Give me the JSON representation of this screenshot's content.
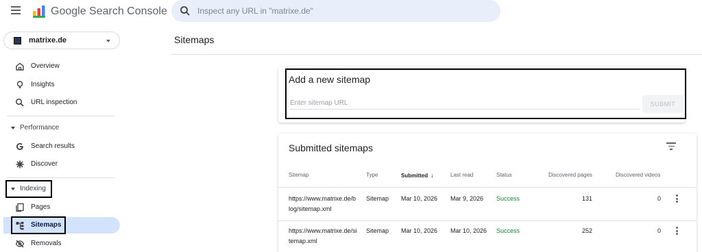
{
  "app": {
    "brand": "Google Search Console",
    "search_placeholder": "Inspect any URL in \"matrixe.de\""
  },
  "property": {
    "name": "matrixe.de"
  },
  "sidebar": {
    "items_top": [
      {
        "label": "Overview",
        "icon": "home-icon"
      },
      {
        "label": "Insights",
        "icon": "lightbulb-icon"
      },
      {
        "label": "URL inspection",
        "icon": "search-icon"
      }
    ],
    "performance": {
      "label": "Performance",
      "items": [
        {
          "label": "Search results",
          "icon": "google-g-icon"
        },
        {
          "label": "Discover",
          "icon": "asterisk-icon"
        }
      ]
    },
    "indexing": {
      "label": "Indexing",
      "items": [
        {
          "label": "Pages",
          "icon": "pages-icon"
        },
        {
          "label": "Sitemaps",
          "icon": "sitemap-icon",
          "active": true
        },
        {
          "label": "Removals",
          "icon": "eye-off-icon"
        }
      ]
    }
  },
  "main": {
    "title": "Sitemaps",
    "add_card": {
      "title": "Add a new sitemap",
      "input_placeholder": "Enter sitemap URL",
      "submit_label": "SUBMIT"
    },
    "submitted_card": {
      "title": "Submitted sitemaps",
      "columns": [
        "Sitemap",
        "Type",
        "Submitted",
        "Last read",
        "Status",
        "Discovered pages",
        "Discovered videos"
      ],
      "sorted_column": "Submitted",
      "rows": [
        {
          "sitemap": "https://www.matrixe.de/blog/sitemap.xml",
          "type": "Sitemap",
          "submitted": "Mar 10, 2026",
          "last_read": "Mar 9, 2026",
          "status": "Success",
          "pages": "131",
          "videos": "0"
        },
        {
          "sitemap": "https://www.matrixe.de/sitemap.xml",
          "type": "Sitemap",
          "submitted": "Mar 10, 2026",
          "last_read": "Mar 10, 2026",
          "status": "Success",
          "pages": "252",
          "videos": "0"
        }
      ]
    }
  },
  "colors": {
    "accent": "#1a73e8",
    "active_nav": "#d3e3fd",
    "search_bg": "#e8eefa",
    "success": "#188038",
    "highlight_border": "#000000"
  }
}
